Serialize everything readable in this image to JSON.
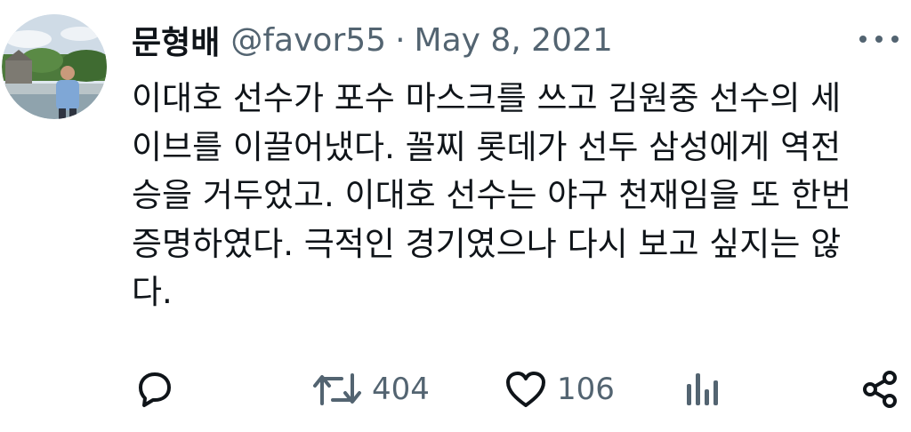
{
  "tweet": {
    "author_name": "문형배",
    "handle": "@favor55",
    "separator": "·",
    "date": "May 8, 2021",
    "text_lines": [
      "이대호 선수가 포수 마스크를 쓰고 김원중 선수의 세",
      "이브를 이끌어냈다. 꼴찌 롯데가 선두 삼성에게 역전",
      "승을 거두었고. 이대호 선수는 야구 천재임을 또 한번",
      "증명하였다. 극적인 경기였으나 다시 보고 싶지는 않",
      "다."
    ]
  },
  "actions": {
    "reply": {
      "icon": "reply-icon"
    },
    "retweet": {
      "icon": "retweet-icon",
      "count": "404"
    },
    "like": {
      "icon": "heart-icon",
      "count": "106"
    },
    "views": {
      "icon": "views-icon"
    },
    "share": {
      "icon": "share-icon"
    }
  },
  "colors": {
    "text": "#0f1419",
    "secondary": "#536471",
    "background": "#ffffff"
  }
}
